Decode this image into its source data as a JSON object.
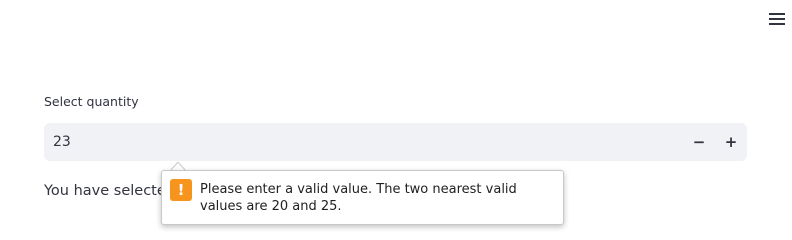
{
  "header": {
    "menu_icon": "hamburger-menu-icon"
  },
  "quantity_input": {
    "label": "Select quantity",
    "value": "23",
    "decrement_label": "−",
    "increment_label": "+"
  },
  "result": {
    "text": "You have selected"
  },
  "validation_tooltip": {
    "icon": "warning-icon",
    "icon_glyph": "!",
    "icon_color": "#f7941d",
    "message": "Please enter a valid value. The two nearest valid values are 20 and 25."
  }
}
